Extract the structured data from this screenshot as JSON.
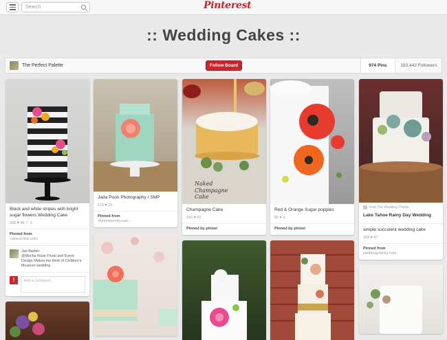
{
  "header": {
    "search_placeholder": "Search",
    "logo": "Pinterest"
  },
  "board": {
    "title": ":: Wedding Cakes ::",
    "owner": "The Perfect Palette",
    "follow_label": "Follow Board",
    "pins": "974 Pins",
    "followers": "193,442 Followers"
  },
  "pins": {
    "p1": {
      "desc": "Black and white stripes with bright sugar flowers Wedding Cake",
      "stats": "335 ♥ 46 ⚐ 1",
      "pinned_label": "Pinned from",
      "source": "cakecentral.com",
      "comment_author": "Jan Barber",
      "comment_text": "@Mocha Rose Floral and Event Design Makes me think of Children's Museum wedding",
      "comment_placeholder": "Add a comment..."
    },
    "p2": {
      "desc": "Jada Poon Photography / SMP",
      "stats": "115 ♥ 24",
      "pinned_label": "Pinned from",
      "source": "stylemepretty.com"
    },
    "p3": {
      "desc": "Champagne Cake",
      "stats": "232 ♥ 42",
      "pinned_by": "Pinned by pinner",
      "overlay": "Naked Champagne Cake"
    },
    "p4": {
      "desc": "Red & Orange Sugar poppies",
      "stats": "65 ♥ 9",
      "pinned_by": "Pinned by pinner"
    },
    "p5": {
      "from": "from The Wedding Chicks",
      "desc": "Lake Tahoe Rainy Day Wedding",
      "desc2": "simple succulent wedding cake",
      "stats": "268 ♥ 47",
      "pinned_label": "Pinned from",
      "source": "weddingchicks.com"
    }
  },
  "colors": {
    "brand": "#c8232c",
    "background": "#e9e9e9"
  }
}
